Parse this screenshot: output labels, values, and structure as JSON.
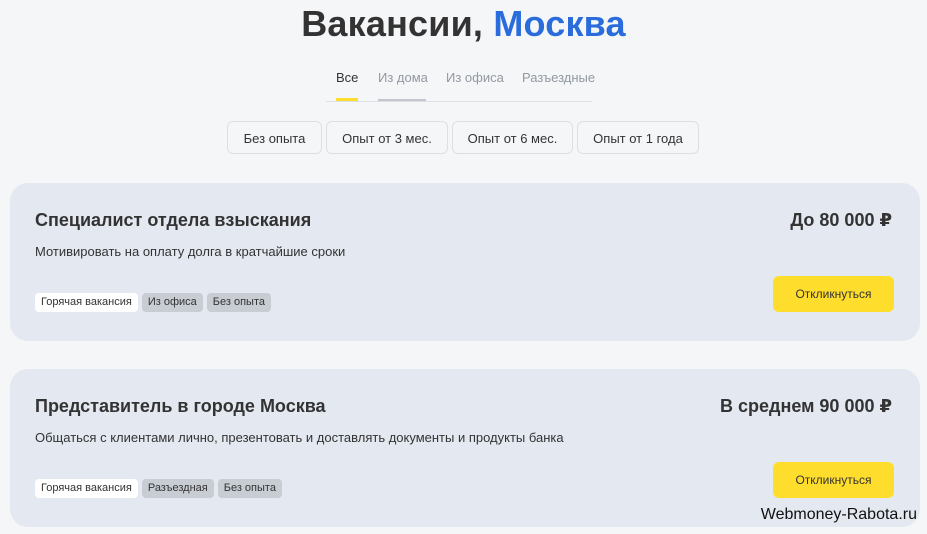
{
  "header": {
    "title_main": "Вакансии,",
    "title_city": "Москва",
    "accent_color": "#2a6cdb"
  },
  "tabs": [
    {
      "label": "Все",
      "active": true
    },
    {
      "label": "Из дома",
      "active": false
    },
    {
      "label": "Из офиса",
      "active": false
    },
    {
      "label": "Разъездные",
      "active": false
    }
  ],
  "filters": [
    {
      "label": "Без опыта"
    },
    {
      "label": "Опыт от 3 мес."
    },
    {
      "label": "Опыт от 6 мес."
    },
    {
      "label": "Опыт от 1 года"
    }
  ],
  "vacancies": [
    {
      "title": "Специалист отдела взыскания",
      "salary": "До 80 000 ₽",
      "description": "Мотивировать на оплату долга в кратчайшие сроки",
      "tags": [
        "Горячая вакансия",
        "Из офиса",
        "Без опыта"
      ],
      "apply_label": "Откликнуться"
    },
    {
      "title": "Представитель в городе Москва",
      "salary": "В среднем 90 000 ₽",
      "description": "Общаться с клиентами лично, презентовать и доставлять документы и продукты банка",
      "tags": [
        "Горячая вакансия",
        "Разъездная",
        "Без опыта"
      ],
      "apply_label": "Откликнуться"
    }
  ],
  "watermark": "Webmoney-Rabota.ru",
  "colors": {
    "button_yellow": "#ffdd2d",
    "card_bg": "#e4e9f1",
    "page_bg": "#f5f6f8"
  }
}
